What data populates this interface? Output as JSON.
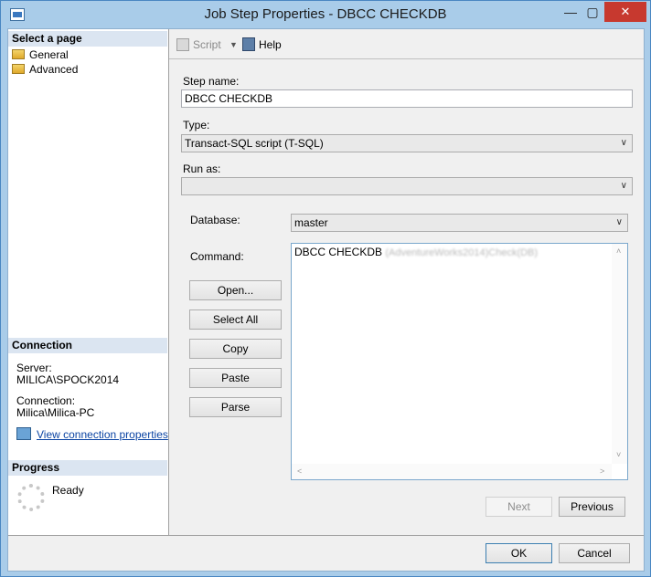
{
  "window": {
    "title": "Job Step Properties - DBCC CHECKDB",
    "minimize_glyph": "—",
    "maximize_glyph": "▢",
    "close_glyph": "✕"
  },
  "sidebar": {
    "select_page_header": "Select a page",
    "pages": [
      {
        "label": "General",
        "icon": "page-icon"
      },
      {
        "label": "Advanced",
        "icon": "page-icon"
      }
    ],
    "connection_header": "Connection",
    "server_label": "Server:",
    "server_value": "MILICA\\SPOCK2014",
    "connection_label": "Connection:",
    "connection_value": "Milica\\Milica-PC",
    "view_connection_link": "View connection properties",
    "progress_header": "Progress",
    "progress_status": "Ready"
  },
  "toolbar": {
    "script_label": "Script",
    "script_arrow": "▼",
    "help_label": "Help"
  },
  "form": {
    "step_name_label": "Step name:",
    "step_name_value": "DBCC CHECKDB",
    "type_label": "Type:",
    "type_value": "Transact-SQL script (T-SQL)",
    "run_as_label": "Run as:",
    "run_as_value": "",
    "database_label": "Database:",
    "database_value": "master",
    "command_label": "Command:",
    "command_text": "DBCC CHECKDB",
    "command_blurred": "(AdventureWorks2014)Check(DB)",
    "combo_arrow": "∨"
  },
  "buttons": {
    "open": "Open...",
    "select_all": "Select All",
    "copy": "Copy",
    "paste": "Paste",
    "parse": "Parse",
    "next": "Next",
    "previous": "Previous",
    "ok": "OK",
    "cancel": "Cancel"
  },
  "scroll": {
    "up": "˄",
    "down": "˅",
    "left": "<",
    "right": ">"
  }
}
